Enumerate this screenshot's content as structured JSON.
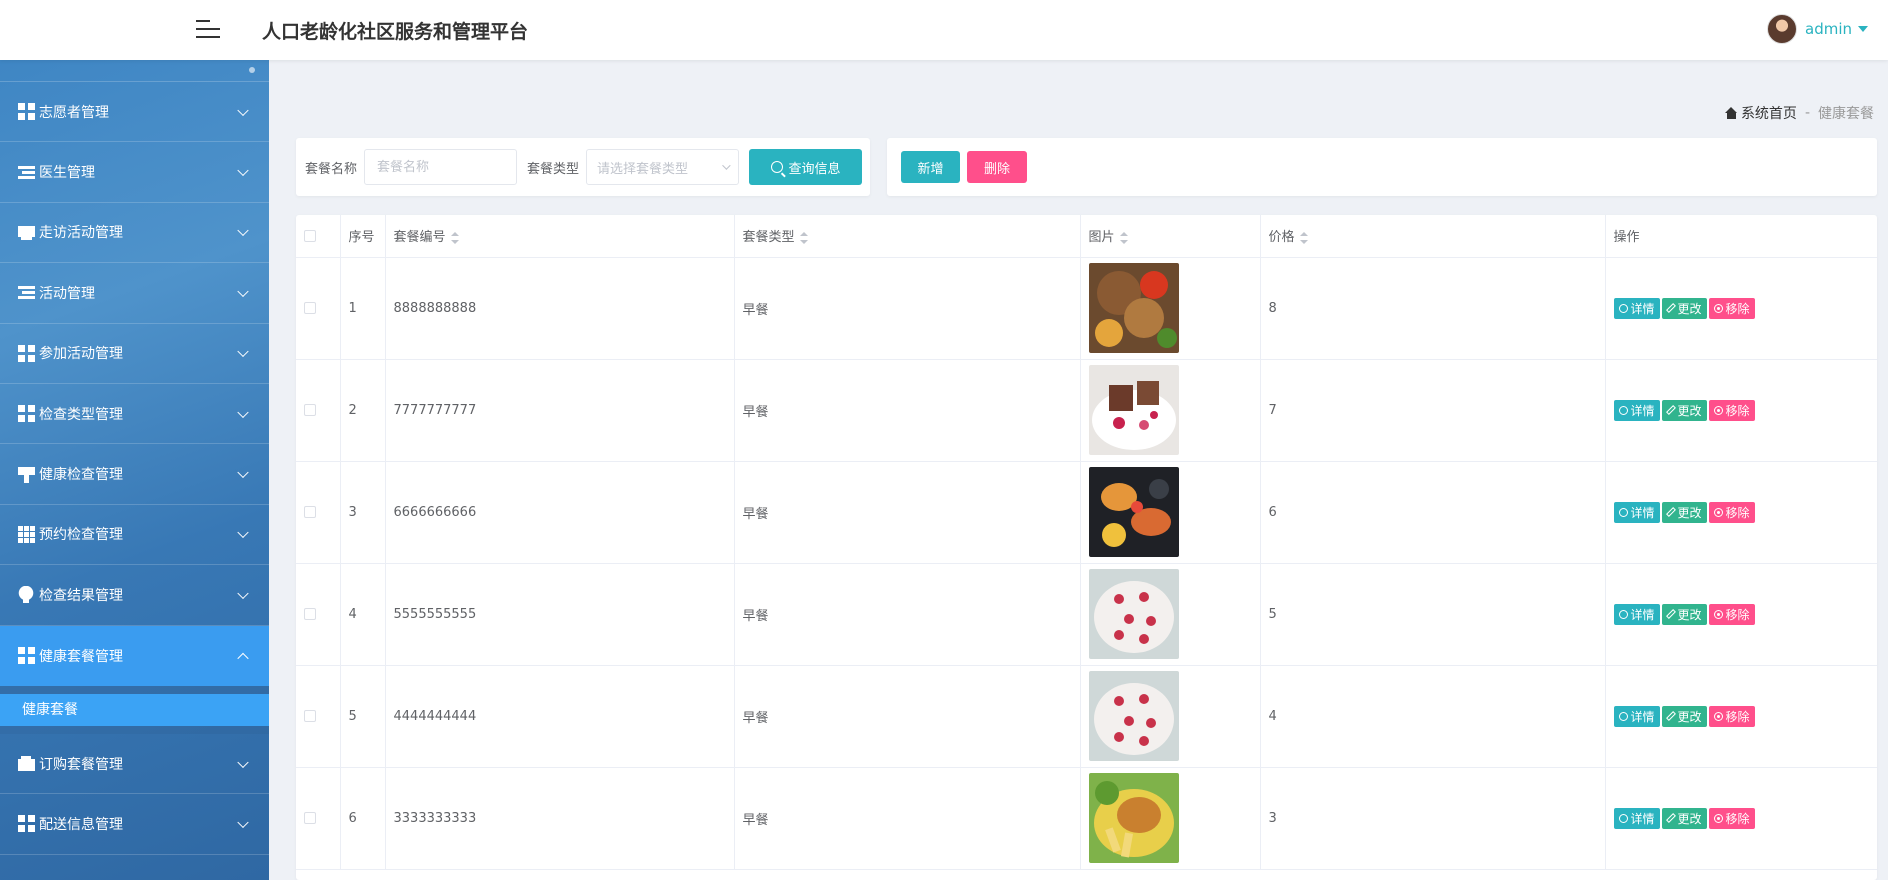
{
  "header": {
    "title": "人口老龄化社区服务和管理平台",
    "user": "admin"
  },
  "sidebar": {
    "items": [
      {
        "label": "志愿者管理",
        "icon": "grid-icon"
      },
      {
        "label": "医生管理",
        "icon": "list-icon"
      },
      {
        "label": "走访活动管理",
        "icon": "tray-icon"
      },
      {
        "label": "活动管理",
        "icon": "list-icon"
      },
      {
        "label": "参加活动管理",
        "icon": "grid-icon"
      },
      {
        "label": "检查类型管理",
        "icon": "grid-icon"
      },
      {
        "label": "健康检查管理",
        "icon": "brush-icon"
      },
      {
        "label": "预约检查管理",
        "icon": "grid9-icon"
      },
      {
        "label": "检查结果管理",
        "icon": "bulb-icon"
      },
      {
        "label": "健康套餐管理",
        "icon": "grid-icon",
        "active": true
      },
      {
        "label": "订购套餐管理",
        "icon": "wallet-icon"
      },
      {
        "label": "配送信息管理",
        "icon": "grid-icon"
      }
    ],
    "submenu": {
      "label": "健康套餐"
    }
  },
  "breadcrumb": {
    "home": "系统首页",
    "separator": "-",
    "current": "健康套餐"
  },
  "search": {
    "name_label": "套餐名称",
    "name_placeholder": "套餐名称",
    "type_label": "套餐类型",
    "type_placeholder": "请选择套餐类型",
    "button": "查询信息"
  },
  "actions": {
    "add": "新增",
    "delete": "删除"
  },
  "table": {
    "columns": {
      "index": "序号",
      "code": "套餐编号",
      "type": "套餐类型",
      "image": "图片",
      "price": "价格",
      "ops": "操作"
    },
    "op_labels": {
      "detail": "详情",
      "edit": "更改",
      "remove": "移除"
    },
    "rows": [
      {
        "index": "1",
        "code": "8888888888",
        "type": "早餐",
        "price": "8",
        "image": "food-photo-chicken-pepper"
      },
      {
        "index": "2",
        "code": "7777777777",
        "type": "早餐",
        "price": "7",
        "image": "food-photo-dessert-plate"
      },
      {
        "index": "3",
        "code": "6666666666",
        "type": "早餐",
        "price": "6",
        "image": "food-photo-seafood-dark"
      },
      {
        "index": "4",
        "code": "5555555555",
        "type": "早餐",
        "price": "5",
        "image": "food-photo-strawberry-plate"
      },
      {
        "index": "5",
        "code": "4444444444",
        "type": "早餐",
        "price": "4",
        "image": "food-photo-strawberry-plate"
      },
      {
        "index": "6",
        "code": "3333333333",
        "type": "早餐",
        "price": "3",
        "image": "food-photo-fried-chicken"
      }
    ]
  },
  "colors": {
    "accent": "#2ab3c0",
    "danger": "#ff4f8b",
    "edit": "#31b48e",
    "sidebar": "#3f86c4",
    "sidebar_active": "#3a9cf0"
  }
}
